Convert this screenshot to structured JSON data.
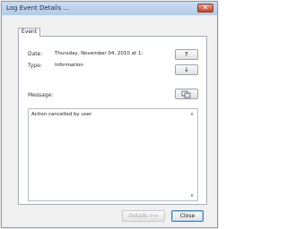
{
  "window": {
    "title": "Log Event Details ..."
  },
  "tabs": [
    {
      "label": "Event"
    }
  ],
  "fields": {
    "date_label": "Date:",
    "date_value": "Thursday, November 04, 2010 at 1:",
    "type_label": "Type:",
    "type_value": "Information",
    "message_label": "Message:"
  },
  "message": {
    "text": "Action cancelled by user"
  },
  "buttons": {
    "prev_symbol": "↑",
    "next_symbol": "↓",
    "copy_icon": "copy-icon",
    "details_label": "Details >>",
    "close_label": "Close"
  },
  "colors": {
    "title_bar": "#b3cbe7",
    "close_button": "#c2432b"
  }
}
